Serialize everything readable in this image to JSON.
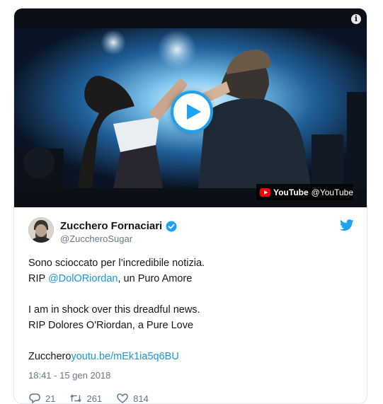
{
  "video": {
    "badge_brand": "YouTube",
    "badge_handle": "@YouTube",
    "accent_color": "#1da1f2"
  },
  "tweet": {
    "display_name": "Zucchero Fornaciari",
    "handle": "@ZuccheroSugar",
    "lines": [
      {
        "text": "Sono scioccato per l’incredibile notizia."
      },
      {
        "prefix": "RIP ",
        "mention": "@DolORiordan",
        "suffix": ", un Puro Amore"
      },
      {
        "text": "I am in shock over this dreadful news."
      },
      {
        "text": "RIP Dolores O'Riordan, a Pure Love"
      },
      {
        "prefix": "Zucchero",
        "link": "youtu.be/mEk1ia5q6BU"
      }
    ],
    "timestamp": "18:41 - 15 gen 2018",
    "replies": "21",
    "retweets": "261",
    "likes": "814",
    "link_color": "#1b95e0"
  }
}
